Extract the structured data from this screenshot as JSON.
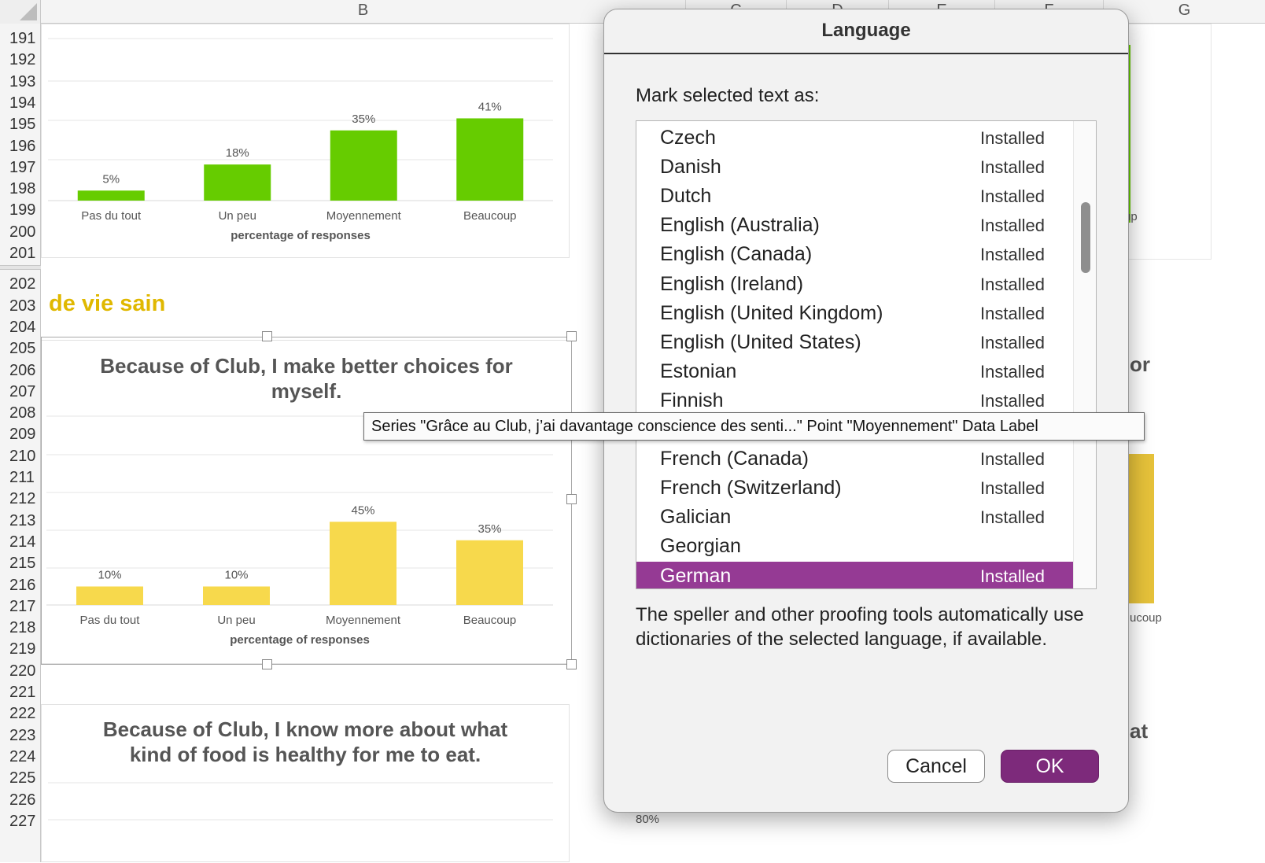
{
  "columns": [
    {
      "letter": "B"
    },
    {
      "letter": "C"
    },
    {
      "letter": "D"
    },
    {
      "letter": "E"
    },
    {
      "letter": "F"
    },
    {
      "letter": "G"
    }
  ],
  "rows": [
    "191",
    "192",
    "193",
    "194",
    "195",
    "196",
    "197",
    "198",
    "199",
    "200",
    "201",
    "202",
    "203",
    "204",
    "205",
    "206",
    "207",
    "208",
    "209",
    "210",
    "211",
    "212",
    "213",
    "214",
    "215",
    "216",
    "217",
    "218",
    "219",
    "220",
    "221",
    "222",
    "223",
    "224",
    "225",
    "226",
    "227"
  ],
  "section_label": "de vie sain",
  "charts": {
    "top": {
      "xlabel": "percentage of responses"
    },
    "middle": {
      "title_line1": "Because of Club, I make better choices for",
      "title_line2": "myself.",
      "xlabel": "percentage of responses"
    },
    "bottom": {
      "title_line1": "Because of Club, I know more about what",
      "title_line2": "kind of food is healthy for me to eat."
    }
  },
  "right_partials": {
    "or": "or",
    "up": "up",
    "ucoup": "ucoup",
    "at": "at",
    "pct80": "80%"
  },
  "chart_data": [
    {
      "type": "bar",
      "categories": [
        "Pas du tout",
        "Un peu",
        "Moyennement",
        "Beaucoup"
      ],
      "values": [
        5,
        18,
        35,
        41
      ],
      "data_labels": [
        "5%",
        "18%",
        "35%",
        "41%"
      ],
      "xlabel": "percentage of responses",
      "color": "#66cc00"
    },
    {
      "type": "bar",
      "title": "Because of Club, I make better choices for myself.",
      "categories": [
        "Pas du tout",
        "Un peu",
        "Moyennement",
        "Beaucoup"
      ],
      "values": [
        10,
        10,
        45,
        35
      ],
      "data_labels": [
        "10%",
        "10%",
        "45%",
        "35%"
      ],
      "xlabel": "percentage of responses",
      "color": "#f7d94c"
    }
  ],
  "tooltip": "Series \"Grâce au Club, j’ai davantage conscience des senti...\" Point \"Moyennement\" Data Label",
  "dialog": {
    "title": "Language",
    "mark_label": "Mark selected text as:",
    "languages": [
      {
        "name": "Czech",
        "status": "Installed"
      },
      {
        "name": "Danish",
        "status": "Installed"
      },
      {
        "name": "Dutch",
        "status": "Installed"
      },
      {
        "name": "English (Australia)",
        "status": "Installed"
      },
      {
        "name": "English (Canada)",
        "status": "Installed"
      },
      {
        "name": "English (Ireland)",
        "status": "Installed"
      },
      {
        "name": "English (United Kingdom)",
        "status": "Installed"
      },
      {
        "name": "English (United States)",
        "status": "Installed"
      },
      {
        "name": "Estonian",
        "status": "Installed"
      },
      {
        "name": "Finnish",
        "status": "Installed"
      },
      {
        "name": "",
        "status": ""
      },
      {
        "name": "French (Canada)",
        "status": "Installed"
      },
      {
        "name": "French (Switzerland)",
        "status": "Installed"
      },
      {
        "name": "Galician",
        "status": "Installed"
      },
      {
        "name": "Georgian",
        "status": ""
      },
      {
        "name": "German",
        "status": "Installed",
        "selected": true
      }
    ],
    "note": "The speller and other proofing tools automatically use dictionaries of the selected language, if available.",
    "cancel_label": "Cancel",
    "ok_label": "OK",
    "accent": "#953a94"
  }
}
